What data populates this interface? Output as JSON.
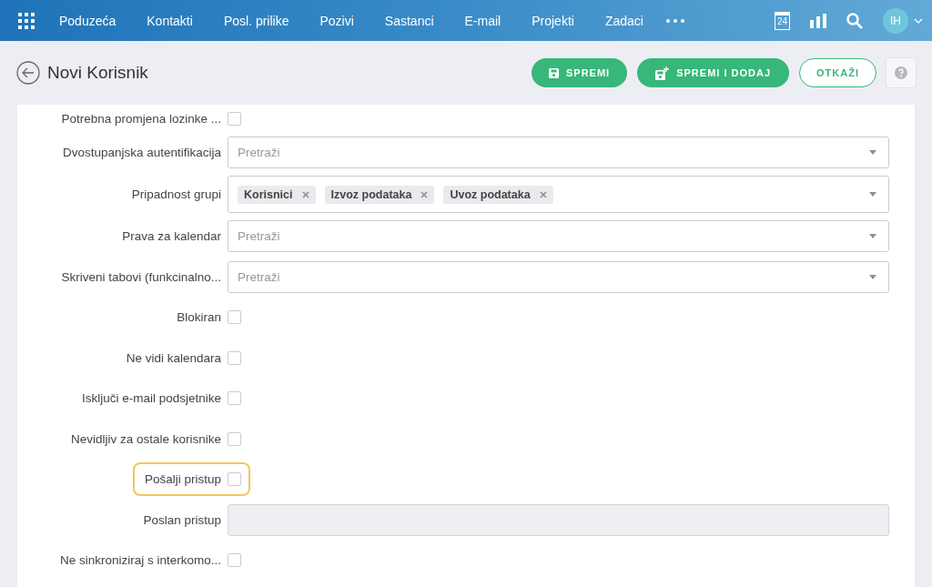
{
  "nav": {
    "items": [
      {
        "label": "Poduzeća"
      },
      {
        "label": "Kontakti"
      },
      {
        "label": "Posl. prilike"
      },
      {
        "label": "Pozivi"
      },
      {
        "label": "Sastanci"
      },
      {
        "label": "E-mail"
      },
      {
        "label": "Projekti"
      },
      {
        "label": "Zadaci"
      }
    ],
    "calendar_day": "24",
    "avatar": "IH"
  },
  "header": {
    "title": "Novi Korisnik",
    "buttons": [
      {
        "label": "SPREMI",
        "kind": "save"
      },
      {
        "label": "SPREMI I DODAJ",
        "kind": "saveadd"
      },
      {
        "label": "OTKAŽI",
        "kind": "outline"
      }
    ]
  },
  "fields": [
    {
      "label": "Potrebna promjena lozinke ...",
      "kind": "checkbox",
      "checked": false,
      "highlighted": false
    },
    {
      "label": "Dvostupanjska autentifikacija",
      "kind": "select",
      "placeholder": "Pretraži",
      "highlighted": false
    },
    {
      "label": "Pripadnost grupi",
      "kind": "tags",
      "tags": [
        "Korisnici",
        "Izvoz podataka",
        "Uvoz podataka"
      ],
      "highlighted": false
    },
    {
      "label": "Prava za kalendar",
      "kind": "select",
      "placeholder": "Pretraži",
      "highlighted": false
    },
    {
      "label": "Skriveni tabovi (funkcinalno...",
      "kind": "select",
      "placeholder": "Pretraži",
      "highlighted": false
    },
    {
      "label": "Blokiran",
      "kind": "checkbox",
      "checked": false,
      "highlighted": false
    },
    {
      "label": "Ne vidi kalendara",
      "kind": "checkbox",
      "checked": false,
      "highlighted": false
    },
    {
      "label": "Isključi e-mail podsjetnike",
      "kind": "checkbox",
      "checked": false,
      "highlighted": false
    },
    {
      "label": "Nevidljiv za ostale korisnike",
      "kind": "checkbox",
      "checked": false,
      "highlighted": false
    },
    {
      "label": "Pošalji pristup",
      "kind": "checkbox",
      "checked": false,
      "highlighted": true
    },
    {
      "label": "Poslan pristup",
      "kind": "text",
      "disabled": true,
      "highlighted": false
    },
    {
      "label": "Ne sinkroniziraj s interkomo...",
      "kind": "checkbox",
      "checked": false,
      "highlighted": false
    }
  ]
}
